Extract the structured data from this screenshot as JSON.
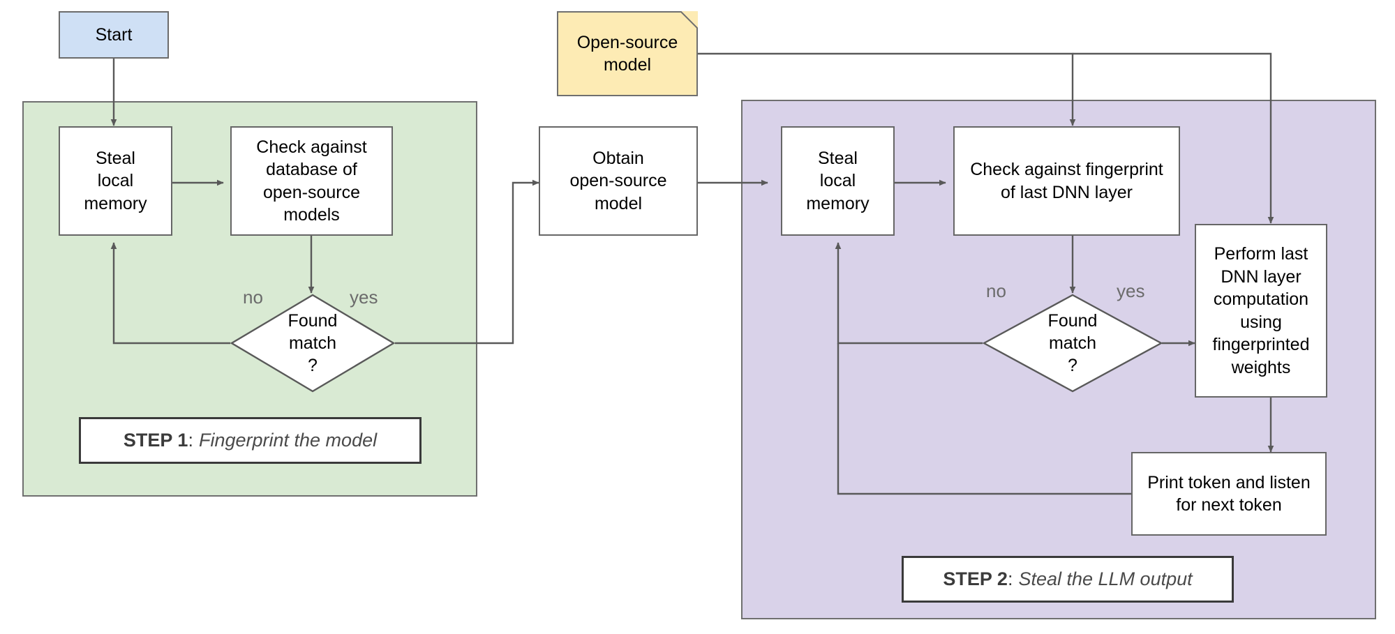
{
  "diagram": {
    "title": "LLM model fingerprinting and output stealing flowchart",
    "colors": {
      "start_fill": "#cfe0f5",
      "document_fill": "#fdebb4",
      "step1_region_fill": "#d9ead3",
      "step2_region_fill": "#d9d2e9",
      "node_fill": "#ffffff",
      "stroke": "#666666",
      "edge_label": "#6b6b6b"
    },
    "nodes": {
      "start": "Start",
      "open_source_model_doc": "Open-source\nmodel",
      "steal_local_memory_1": "Steal\nlocal\nmemory",
      "check_db": "Check against\ndatabase of\nopen-source\nmodels",
      "found_match_1": "Found\nmatch\n?",
      "obtain_open_source_model": "Obtain\nopen-source\nmodel",
      "steal_local_memory_2": "Steal\nlocal\nmemory",
      "check_fingerprint": "Check against fingerprint\nof last DNN layer",
      "found_match_2": "Found\nmatch\n?",
      "perform_last_layer": "Perform last\nDNN layer\ncomputation\nusing\nfingerprinted\nweights",
      "print_token": "Print token and listen\nfor next token"
    },
    "node_lines": {
      "open_source_model_doc": [
        "Open-source",
        "model"
      ],
      "steal_local_memory_1": [
        "Steal",
        "local",
        "memory"
      ],
      "check_db": [
        "Check against",
        "database of",
        "open-source",
        "models"
      ],
      "found_match_1": [
        "Found",
        "match",
        "?"
      ],
      "obtain_open_source_model": [
        "Obtain",
        "open-source",
        "model"
      ],
      "steal_local_memory_2": [
        "Steal",
        "local",
        "memory"
      ],
      "check_fingerprint": [
        "Check against fingerprint",
        "of last DNN layer"
      ],
      "found_match_2": [
        "Found",
        "match",
        "?"
      ],
      "perform_last_layer": [
        "Perform last",
        "DNN layer",
        "computation",
        "using",
        "fingerprinted",
        "weights"
      ],
      "print_token": [
        "Print token and listen",
        "for next token"
      ]
    },
    "edge_labels": {
      "step1_no": "no",
      "step1_yes": "yes",
      "step2_no": "no",
      "step2_yes": "yes"
    },
    "steps": [
      {
        "key": "STEP 1",
        "separator": ":",
        "value": "Fingerprint the model"
      },
      {
        "key": "STEP 2",
        "separator": ":",
        "value": "Steal the LLM output"
      }
    ]
  }
}
